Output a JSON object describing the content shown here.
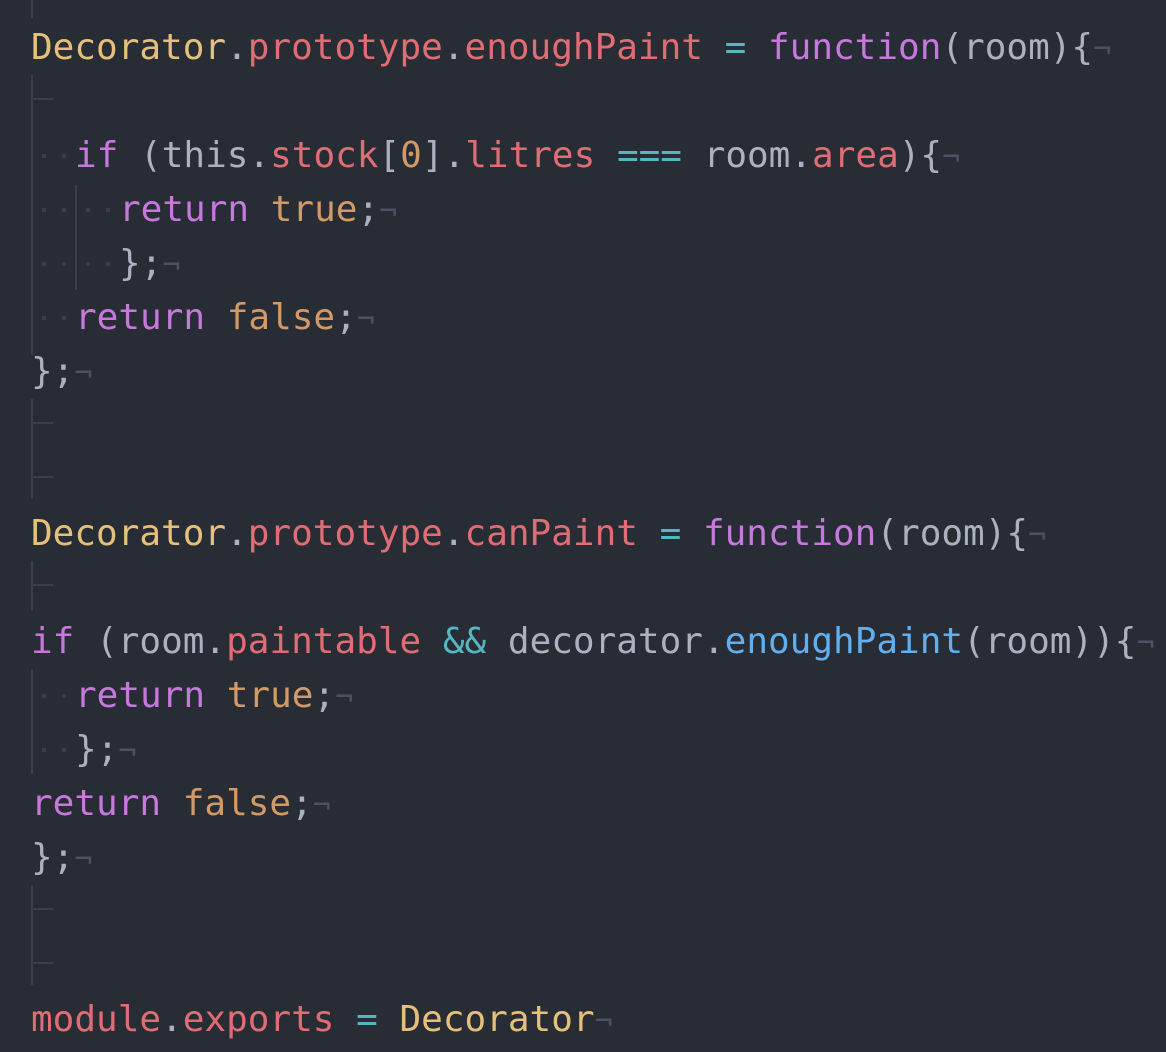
{
  "code": {
    "line1": {
      "cls": "Decorator",
      "dot1": ".",
      "prop1": "prototype",
      "dot2": ".",
      "prop2": "enoughPaint",
      "eq": " = ",
      "kw": "function",
      "args": "(room){",
      "eol": "¬"
    },
    "line3": {
      "kw": "if",
      "paren": " (",
      "this": "this",
      "dot1": ".",
      "prop1": "stock",
      "bracket_open": "[",
      "num": "0",
      "bracket_close": "]",
      "dot2": ".",
      "prop2": "litres",
      "op": " === ",
      "obj": "room",
      "dot3": ".",
      "prop3": "area",
      "close": "){",
      "eol": "¬"
    },
    "line4": {
      "kw": "return",
      "val": "true",
      "semi": ";",
      "eol": "¬"
    },
    "line5": {
      "text": "};",
      "eol": "¬"
    },
    "line6": {
      "kw": "return",
      "val": "false",
      "semi": ";",
      "eol": "¬"
    },
    "line7": {
      "text": "};",
      "eol": "¬"
    },
    "line10": {
      "cls": "Decorator",
      "dot1": ".",
      "prop1": "prototype",
      "dot2": ".",
      "prop2": "canPaint",
      "eq": " = ",
      "kw": "function",
      "args": "(room){",
      "eol": "¬"
    },
    "line12": {
      "kw": "if",
      "paren": " (",
      "obj": "room",
      "dot1": ".",
      "prop1": "paintable",
      "op": " && ",
      "obj2": "decorator",
      "dot2": ".",
      "fn": "enoughPaint",
      "close": "(room)){",
      "eol": "¬"
    },
    "line13": {
      "kw": "return",
      "val": "true",
      "semi": ";",
      "eol": "¬"
    },
    "line14": {
      "text": "};",
      "eol": "¬"
    },
    "line15": {
      "kw": "return",
      "val": "false",
      "semi": ";",
      "eol": "¬"
    },
    "line16": {
      "text": "};",
      "eol": "¬"
    },
    "line19": {
      "obj": "module",
      "dot": ".",
      "prop": "exports",
      "eq": " = ",
      "cls": "Decorator",
      "eol": "¬"
    }
  },
  "colors": {
    "background": "#282c34",
    "class": "#e5c07b",
    "property": "#e06c75",
    "operator": "#56b6c2",
    "keyword": "#c678dd",
    "number": "#d19a66",
    "function": "#61afef",
    "invisible": "#4b5263"
  }
}
